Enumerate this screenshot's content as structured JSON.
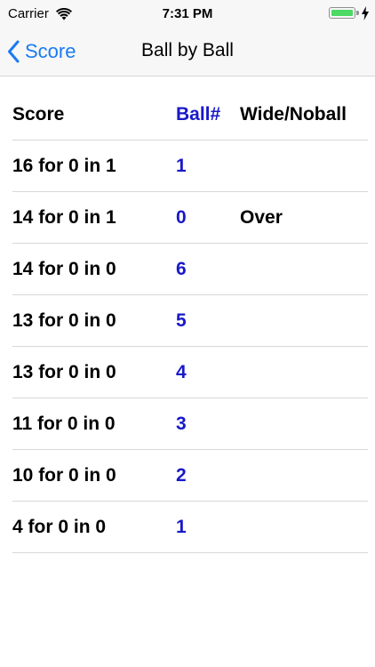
{
  "status_bar": {
    "carrier": "Carrier",
    "time": "7:31 PM",
    "battery_color": "#4cd964"
  },
  "nav": {
    "back_label": "Score",
    "title": "Ball by Ball",
    "accent_color": "#1a7bf2"
  },
  "table": {
    "headers": {
      "score": "Score",
      "ball": "Ball#",
      "wide": "Wide/Noball"
    },
    "rows": [
      {
        "score": "16 for 0 in 1",
        "ball": "1",
        "wide": ""
      },
      {
        "score": "14 for 0 in 1",
        "ball": "0",
        "wide": "Over"
      },
      {
        "score": "14 for 0 in 0",
        "ball": "6",
        "wide": ""
      },
      {
        "score": "13 for 0 in 0",
        "ball": "5",
        "wide": ""
      },
      {
        "score": "13 for 0 in 0",
        "ball": "4",
        "wide": ""
      },
      {
        "score": "11 for 0 in 0",
        "ball": "3",
        "wide": ""
      },
      {
        "score": "10 for 0 in 0",
        "ball": "2",
        "wide": ""
      },
      {
        "score": "4 for 0 in 0",
        "ball": "1",
        "wide": ""
      }
    ]
  }
}
